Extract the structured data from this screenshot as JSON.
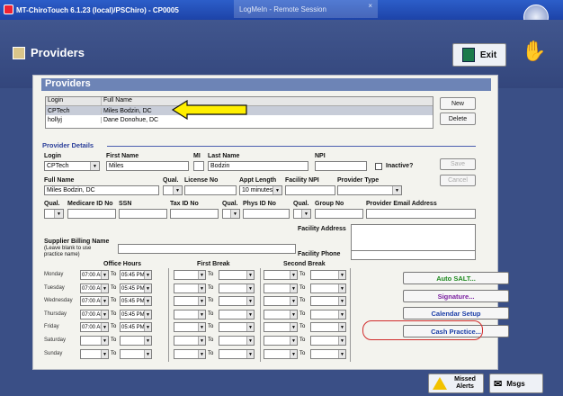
{
  "window": {
    "title": "MT-ChiroTouch 6.1.23 (local)/PSChiro) - CP0005",
    "remote_title": "LogMeIn - Remote Session",
    "close": "×"
  },
  "header": {
    "title": "Providers",
    "exit_label": "Exit"
  },
  "dialog": {
    "title": "Providers",
    "list": {
      "columns": [
        "Login",
        "Full Name"
      ],
      "rows": [
        {
          "login": "CPTech",
          "full_name": "Miles Bodzin, DC"
        },
        {
          "login": "hollyj",
          "full_name": "Dane Donohue, DC"
        }
      ]
    },
    "new_label": "New",
    "delete_label": "Delete",
    "details_title": "Provider Details",
    "labels": {
      "login": "Login",
      "first_name": "First Name",
      "mi": "MI",
      "last_name": "Last Name",
      "npi": "NPI",
      "inactive": "Inactive?",
      "full_name": "Full Name",
      "qual": "Qual.",
      "license_no": "License No",
      "appt_length": "Appt Length",
      "facility_npi": "Facility NPI",
      "provider_type": "Provider Type",
      "medicare_id": "Medicare ID No",
      "ssn": "SSN",
      "tax_id": "Tax ID No",
      "phys_id": "Phys ID No",
      "group_no": "Group No",
      "email": "Provider Email Address",
      "facility_address": "Facility Address",
      "supplier_billing": "Supplier Billing Name",
      "supplier_hint": "(Leave blank to use practice name)",
      "facility_phone": "Facility Phone",
      "office_hours": "Office Hours",
      "first_break": "First Break",
      "second_break": "Second Break",
      "to": "To"
    },
    "values": {
      "login": "CPTech",
      "first_name": "Miles",
      "last_name": "Bodzin",
      "full_name": "Miles Bodzin, DC",
      "appt_length": "10 minutes"
    },
    "save_label": "Save",
    "cancel_label": "Cancel",
    "schedule": [
      {
        "day": "Monday",
        "start": "07:00 AM",
        "end": "05:45 PM"
      },
      {
        "day": "Tuesday",
        "start": "07:00 AM",
        "end": "05:45 PM"
      },
      {
        "day": "Wednesday",
        "start": "07:00 AM",
        "end": "05:45 PM"
      },
      {
        "day": "Thursday",
        "start": "07:00 AM",
        "end": "05:45 PM"
      },
      {
        "day": "Friday",
        "start": "07:00 AM",
        "end": "05:45 PM"
      },
      {
        "day": "Saturday",
        "start": "",
        "end": ""
      },
      {
        "day": "Sunday",
        "start": "",
        "end": ""
      }
    ],
    "actions": {
      "auto_salt": "Auto SALT...",
      "signature": "Signature...",
      "calendar_setup": "Calendar Setup",
      "cash_practice": "Cash Practice..."
    },
    "action_colors": {
      "auto_salt": "#1e8a1e",
      "signature": "#7a1fa0",
      "calendar_setup": "#1c3fa8",
      "cash_practice": "#1c3fa8"
    }
  },
  "status": {
    "missed_alerts": "Missed Alerts",
    "msgs": "Msgs"
  }
}
